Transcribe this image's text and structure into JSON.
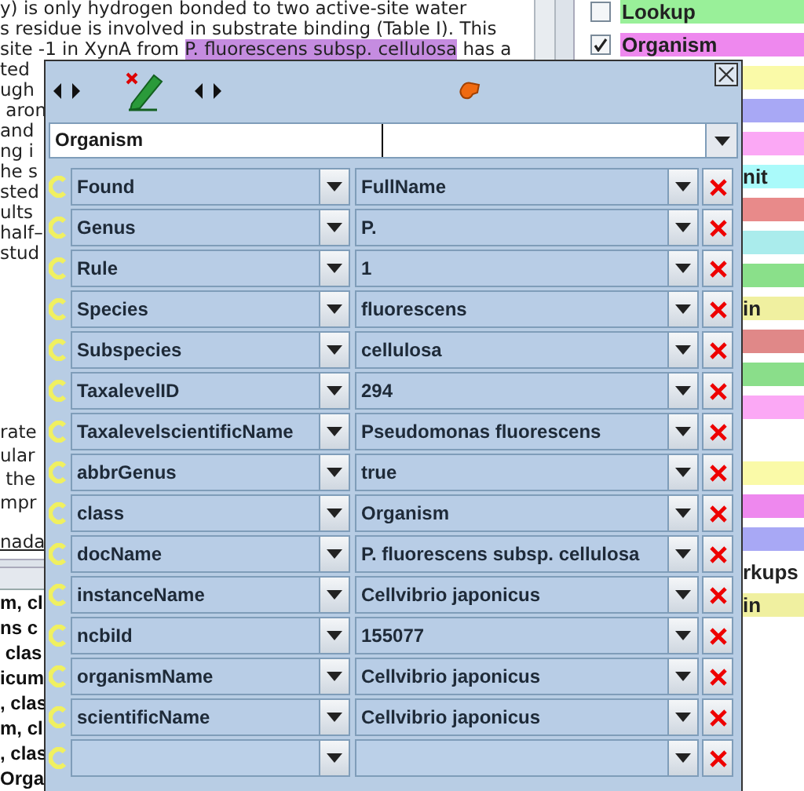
{
  "document": {
    "paragraphs": [
      [
        {
          "text": "y) is only hydrogen bonded to two active-site water"
        },
        {
          "text": "s residue is involved in substrate binding (Table I). This"
        },
        {
          "text": "site -1 in XynA from ",
          "annotation": "P. fluorescens subsp. cellulosa",
          "after": " has a"
        },
        {
          "text": "ted"
        },
        {
          "text": "ugh"
        },
        {
          "text": " aron"
        },
        {
          "text": "and"
        },
        {
          "text": "ng i"
        },
        {
          "text": "he s"
        },
        {
          "text": "sted"
        },
        {
          "text": "ults"
        },
        {
          "text": "half–"
        },
        {
          "text": "stud"
        }
      ],
      [
        {
          "text": "rate"
        },
        {
          "text": "ular"
        },
        {
          "text": " the"
        },
        {
          "text": "mpr"
        }
      ]
    ],
    "link": "nada"
  },
  "results_table": {
    "rows": [
      "m, cl",
      "ns c",
      " clas",
      "icum",
      ", clas",
      "m, cl",
      ", clas",
      "Orga"
    ]
  },
  "annotation_types": [
    {
      "kind": "checkbox",
      "label": "Lookup",
      "checked": false,
      "color": "#99f099"
    },
    {
      "kind": "checkbox",
      "label": "Organism",
      "checked": true,
      "color": "#ee88ee"
    },
    {
      "kind": "bar",
      "color": "#fafaa8"
    },
    {
      "kind": "bar",
      "color": "#a8a8f5"
    },
    {
      "kind": "bar",
      "color": "#fba8f5"
    },
    {
      "kind": "bar",
      "color": "#aafafa",
      "label": "nit"
    },
    {
      "kind": "bar",
      "color": "#e88a8a"
    },
    {
      "kind": "bar",
      "color": "#aaecec"
    },
    {
      "kind": "bar",
      "color": "#8ae08a"
    },
    {
      "kind": "bar",
      "color": "#f0f0a0",
      "label": "in"
    },
    {
      "kind": "bar",
      "color": "#e08888"
    },
    {
      "kind": "bar",
      "color": "#8ade8a"
    },
    {
      "kind": "bar",
      "color": "#fba8f5"
    },
    {
      "kind": "plain"
    },
    {
      "kind": "bar",
      "color": "#fafaa8"
    },
    {
      "kind": "bar",
      "color": "#ee88ee"
    },
    {
      "kind": "bar",
      "color": "#a8a8f5"
    },
    {
      "kind": "plain",
      "label": "rkups"
    },
    {
      "kind": "bar",
      "color": "#f0f0a0",
      "label": "in"
    }
  ],
  "dialog": {
    "type_value": "Organism",
    "features": [
      {
        "name": "Found",
        "value": "FullName"
      },
      {
        "name": "Genus",
        "value": "P."
      },
      {
        "name": "Rule",
        "value": "1"
      },
      {
        "name": "Species",
        "value": "fluorescens"
      },
      {
        "name": "Subspecies",
        "value": "cellulosa"
      },
      {
        "name": "TaxalevelID",
        "value": "294"
      },
      {
        "name": "TaxalevelscientificName",
        "value": "Pseudomonas fluorescens"
      },
      {
        "name": "abbrGenus",
        "value": "true"
      },
      {
        "name": "class",
        "value": "Organism"
      },
      {
        "name": "docName",
        "value": "P. fluorescens subsp. cellulosa"
      },
      {
        "name": "instanceName",
        "value": "Cellvibrio japonicus"
      },
      {
        "name": "ncbiId",
        "value": "155077"
      },
      {
        "name": "organismName",
        "value": "Cellvibrio japonicus"
      },
      {
        "name": "scientificName",
        "value": "Cellvibrio japonicus"
      }
    ]
  }
}
